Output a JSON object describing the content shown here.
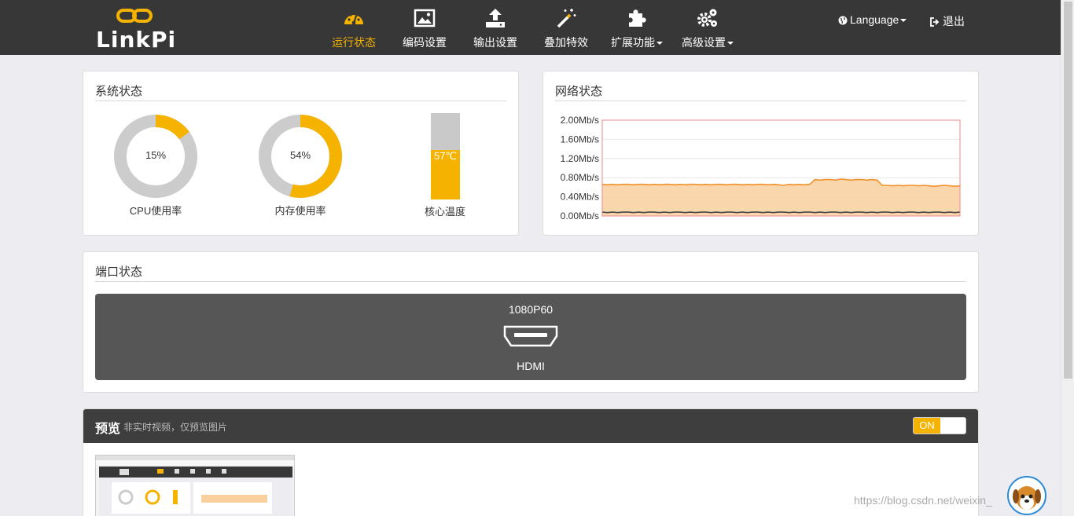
{
  "brand": {
    "name": "LinkPi"
  },
  "nav": {
    "items": [
      {
        "label": "运行状态",
        "icon": "dashboard-icon",
        "active": true
      },
      {
        "label": "编码设置",
        "icon": "image-icon",
        "active": false
      },
      {
        "label": "输出设置",
        "icon": "upload-icon",
        "active": false
      },
      {
        "label": "叠加特效",
        "icon": "magic-wand-icon",
        "active": false
      },
      {
        "label": "扩展功能",
        "icon": "puzzle-icon",
        "active": false,
        "dropdown": true
      },
      {
        "label": "高级设置",
        "icon": "cogs-icon",
        "active": false,
        "dropdown": true
      }
    ],
    "language": "Language",
    "logout": "退出"
  },
  "system_status": {
    "title": "系统状态",
    "cpu": {
      "value": 15,
      "text": "15%",
      "label": "CPU使用率"
    },
    "memory": {
      "value": 54,
      "text": "54%",
      "label": "内存使用率"
    },
    "temperature": {
      "value": 57,
      "text": "57℃",
      "label": "核心温度"
    }
  },
  "network_status": {
    "title": "网络状态"
  },
  "chart_data": {
    "type": "area",
    "y_ticks": [
      "2.00Mb/s",
      "1.60Mb/s",
      "1.20Mb/s",
      "0.80Mb/s",
      "0.40Mb/s",
      "0.00Mb/s"
    ],
    "ylim": [
      0,
      2.0
    ],
    "y_unit": "Mb/s",
    "grid": true,
    "series": [
      {
        "color": "#f4902a",
        "fill": "#f9cf9d",
        "values": [
          0.66,
          0.65,
          0.66,
          0.65,
          0.66,
          0.66,
          0.65,
          0.66,
          0.66,
          0.65,
          0.66,
          0.65,
          0.66,
          0.66,
          0.65,
          0.66,
          0.65,
          0.66,
          0.66,
          0.65,
          0.66,
          0.65,
          0.66,
          0.66,
          0.65,
          0.66,
          0.66,
          0.65,
          0.66,
          0.65,
          0.66,
          0.66,
          0.65,
          0.66,
          0.65,
          0.64,
          0.66,
          0.65,
          0.66,
          0.65,
          0.66,
          0.76,
          0.75,
          0.76,
          0.76,
          0.75,
          0.77,
          0.76,
          0.75,
          0.76,
          0.76,
          0.75,
          0.76,
          0.75,
          0.64,
          0.64,
          0.63,
          0.64,
          0.63,
          0.64,
          0.64,
          0.63,
          0.64,
          0.63,
          0.62,
          0.63,
          0.64,
          0.63,
          0.62,
          0.63
        ]
      },
      {
        "color": "#444444",
        "fill": "none",
        "values": [
          0.08,
          0.07,
          0.08,
          0.07,
          0.08,
          0.08,
          0.07,
          0.08,
          0.07,
          0.08,
          0.08,
          0.07,
          0.08,
          0.07,
          0.08,
          0.08,
          0.07,
          0.08,
          0.07,
          0.08,
          0.08,
          0.07,
          0.08,
          0.07,
          0.08,
          0.08,
          0.07,
          0.08,
          0.07,
          0.08,
          0.08,
          0.07,
          0.08,
          0.07,
          0.08,
          0.08,
          0.07,
          0.08,
          0.07,
          0.08,
          0.08,
          0.07,
          0.08,
          0.07,
          0.08,
          0.08,
          0.07,
          0.08,
          0.07,
          0.08,
          0.08,
          0.07,
          0.08,
          0.07,
          0.08,
          0.08,
          0.07,
          0.08,
          0.07,
          0.08,
          0.08,
          0.07,
          0.08,
          0.07,
          0.08,
          0.08,
          0.07,
          0.08,
          0.07,
          0.08
        ]
      }
    ]
  },
  "port_status": {
    "title": "端口状态",
    "resolution": "1080P60",
    "port_name": "HDMI"
  },
  "preview": {
    "title": "预览",
    "subtitle": "非实时视频，仅预览图片",
    "toggle_label": "ON"
  },
  "watermark": "https://blog.csdn.net/weixin_      0034",
  "colors": {
    "accent": "#f5b300",
    "navbar": "#373737",
    "gauge_track": "#cccccc"
  }
}
